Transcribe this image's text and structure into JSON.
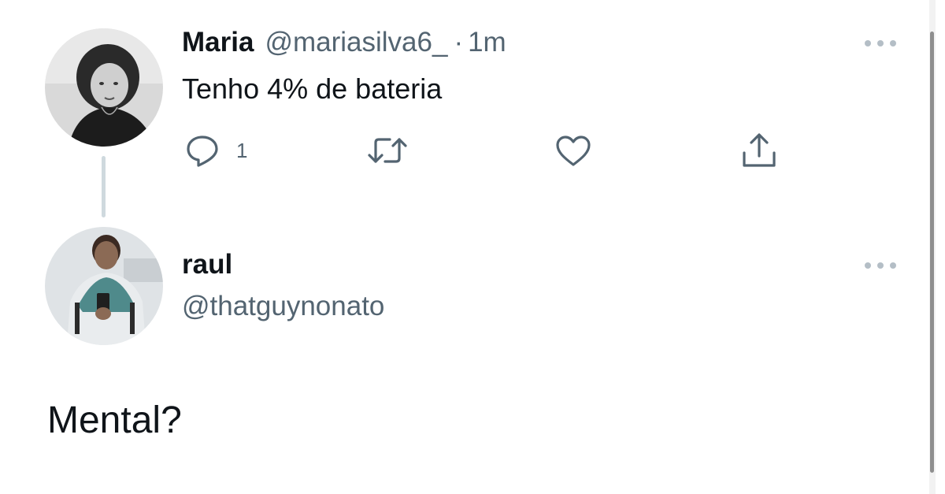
{
  "tweets": [
    {
      "name": "Maria",
      "handle": "@mariasilva6_",
      "separator": "·",
      "time": "1m",
      "text": "Tenho 4% de bateria",
      "reply_count": "1",
      "icons": [
        "reply-icon",
        "retweet-icon",
        "like-icon",
        "share-icon",
        "more-icon"
      ]
    },
    {
      "name": "raul",
      "handle": "@thatguynonato",
      "text": "Mental?",
      "icons": [
        "more-icon"
      ]
    }
  ],
  "colors": {
    "text_primary": "#0f1419",
    "text_secondary": "#536471",
    "thread_line": "#cfd9de",
    "background": "#ffffff"
  }
}
